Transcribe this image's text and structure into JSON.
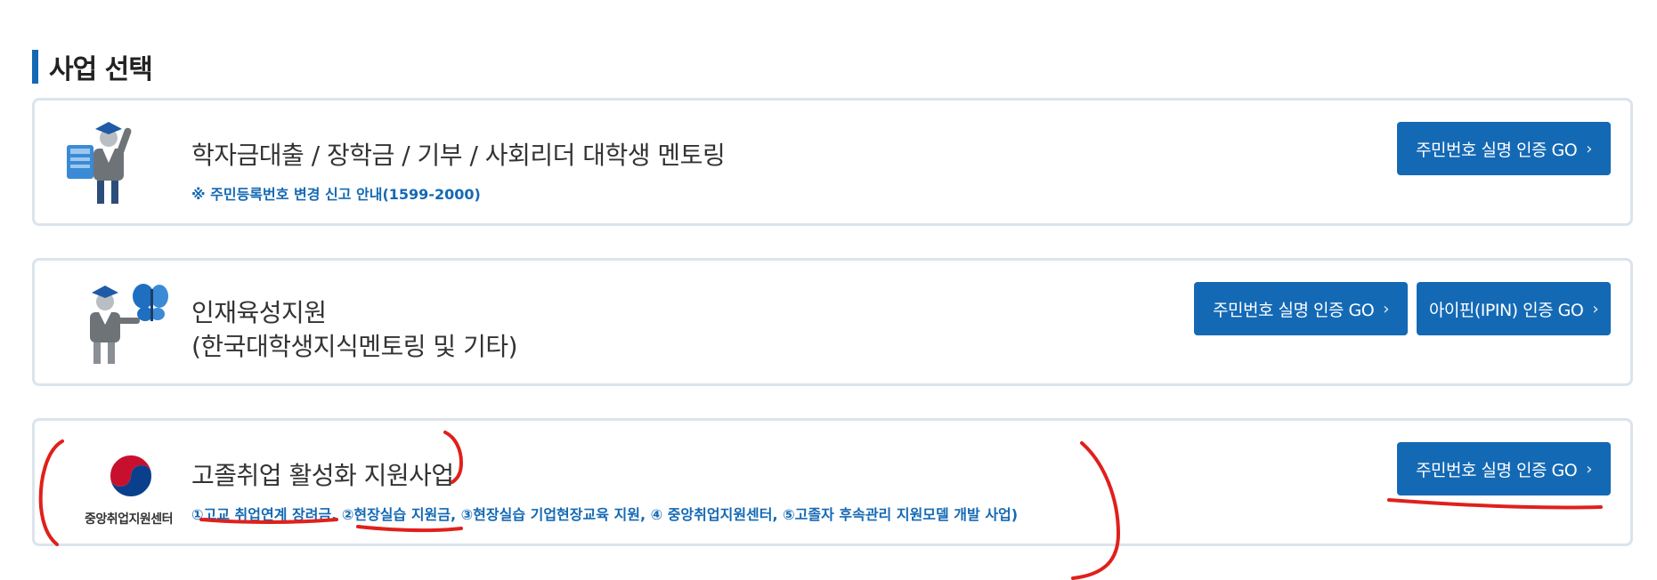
{
  "section": {
    "title": "사업 선택"
  },
  "cards": [
    {
      "icon": "graduate-with-book-icon",
      "title": "학자금대출 / 장학금 / 기부 / 사회리더 대학생 멘토링",
      "notice": "※ 주민등록번호 변경 신고 안내(1599-2000)",
      "buttons": {
        "rrn": "주민번호 실명 인증 GO"
      }
    },
    {
      "icon": "graduate-with-butterfly-icon",
      "title_line1": "인재육성지원",
      "title_line2": "(한국대학생지식멘토링 및 기타)",
      "buttons": {
        "rrn": "주민번호 실명 인증 GO",
        "ipin": "아이핀(IPIN) 인증 GO"
      }
    },
    {
      "icon": "government-emblem-icon",
      "logo_text": "중앙취업지원센터",
      "title": "고졸취업 활성화 지원사업",
      "programs": "①고교 취업연계 장려금, ②현장실습 지원금, ③현장실습 기업현장교육 지원, ④ 중앙취업지원센터, ⑤고졸자 후속관리 지원모델 개발 사업)",
      "buttons": {
        "rrn": "주민번호 실명 인증 GO"
      }
    }
  ],
  "colors": {
    "accent": "#1469b4",
    "border": "#dbe4ec",
    "annotation": "#e0201b"
  }
}
